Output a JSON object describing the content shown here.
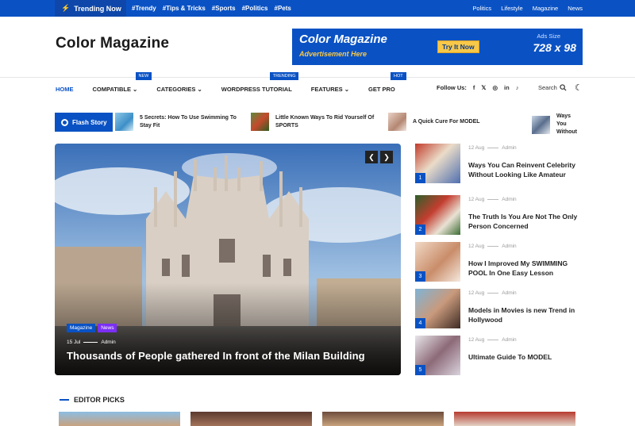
{
  "topbar": {
    "trending_label": "Trending Now",
    "tags": [
      "#Trendy",
      "#Tips & Tricks",
      "#Sports",
      "#Politics",
      "#Pets"
    ],
    "links": [
      "Politics",
      "Lifestyle",
      "Magazine",
      "News"
    ]
  },
  "header": {
    "logo": "Color Magazine",
    "ad": {
      "title": "Color Magazine",
      "subtitle": "Advertisement Here",
      "button": "Try It Now",
      "size_label": "Ads Size",
      "size": "728 x 98"
    }
  },
  "nav": {
    "items": [
      {
        "label": "HOME",
        "badge": ""
      },
      {
        "label": "COMPATIBLE ⌄",
        "badge": "NEW"
      },
      {
        "label": "CATEGORIES ⌄",
        "badge": ""
      },
      {
        "label": "WORDPRESS TUTORIAL",
        "badge": "TRENDING"
      },
      {
        "label": "FEATURES ⌄",
        "badge": ""
      },
      {
        "label": "GET PRO",
        "badge": "HOT"
      }
    ],
    "follow_label": "Follow Us:",
    "social": [
      "f",
      "𝕏",
      "◎",
      "in",
      "♪"
    ],
    "search_label": "Search"
  },
  "flash": {
    "label": "Flash Story",
    "items": [
      {
        "text": "5 Secrets: How To Use Swimming To Stay Fit"
      },
      {
        "text": "Little Known Ways To Rid Yourself Of SPORTS"
      },
      {
        "text": "A Quick Cure For MODEL"
      },
      {
        "text": "Ways You Without"
      }
    ]
  },
  "hero": {
    "tag1": "Magazine",
    "tag2": "News",
    "date": "15 Jul",
    "author": "Admin",
    "title": "Thousands of People gathered In front of the Milan Building"
  },
  "sidebar": {
    "posts": [
      {
        "num": "1",
        "date": "12 Aug",
        "author": "Admin",
        "title": "Ways You Can Reinvent Celebrity Without Looking Like Amateur"
      },
      {
        "num": "2",
        "date": "12 Aug",
        "author": "Admin",
        "title": "The Truth Is You Are Not The Only Person Concerned"
      },
      {
        "num": "3",
        "date": "12 Aug",
        "author": "Admin",
        "title": "How I Improved My SWIMMING POOL In One Easy Lesson"
      },
      {
        "num": "4",
        "date": "12 Aug",
        "author": "Admin",
        "title": "Models in Movies is new Trend in Hollywood"
      },
      {
        "num": "5",
        "date": "12 Aug",
        "author": "Admin",
        "title": "Ultimate Guide To MODEL"
      }
    ]
  },
  "editor_picks": {
    "label": "EDITOR PICKS"
  },
  "colors": {
    "brand_blue": "#0a52c4",
    "accent_yellow": "#f7c84a",
    "news_purple": "#7b2ff7"
  }
}
